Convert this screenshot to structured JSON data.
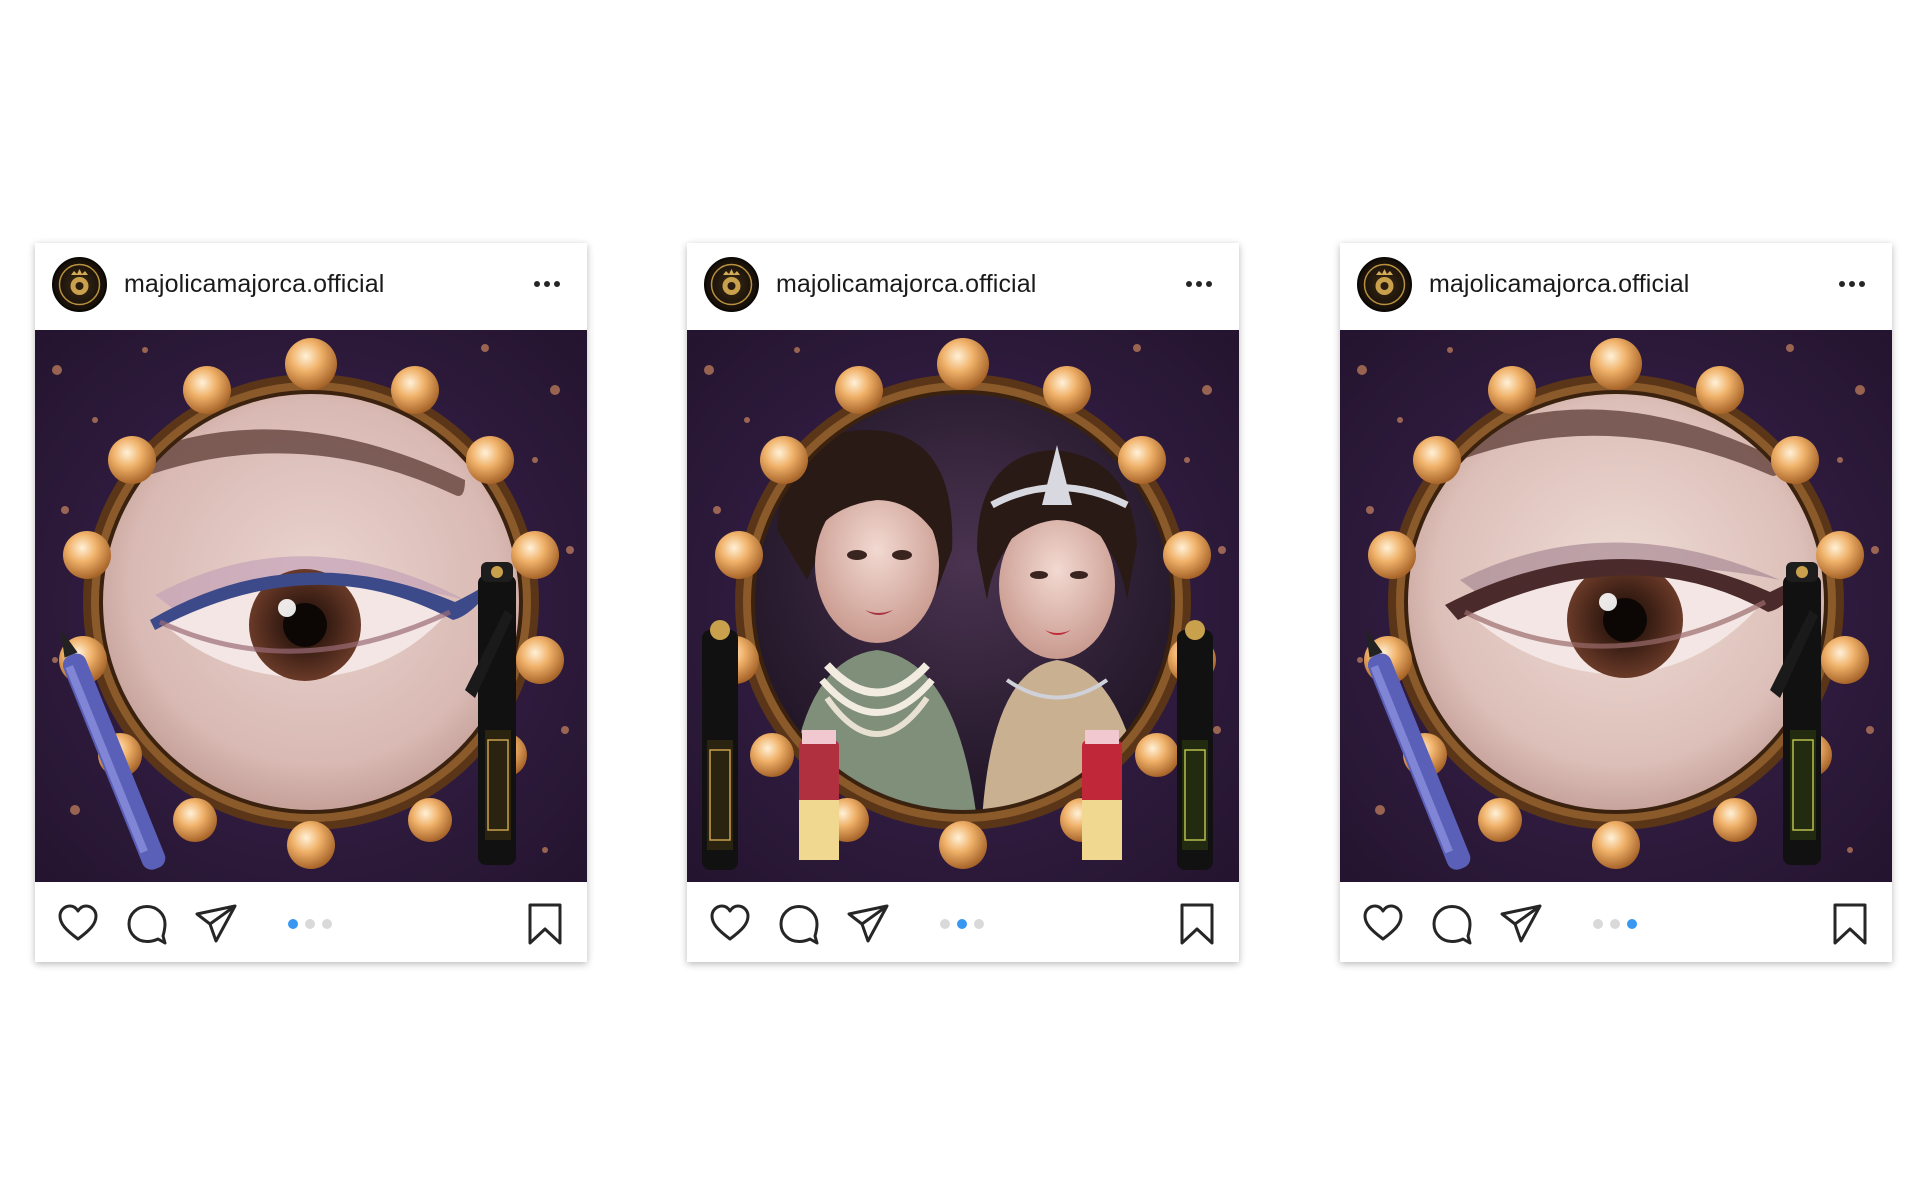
{
  "posts": [
    {
      "username": "majolicamajorca.official",
      "image_subject": "eye-closeup-blue-liner",
      "carousel": {
        "count": 3,
        "active": 1
      }
    },
    {
      "username": "majolicamajorca.official",
      "image_subject": "two-models-1920s-style",
      "carousel": {
        "count": 3,
        "active": 2
      }
    },
    {
      "username": "majolicamajorca.official",
      "image_subject": "eye-closeup-brown-liner",
      "carousel": {
        "count": 3,
        "active": 3
      }
    }
  ],
  "icons": {
    "more": "more-horizontal-icon",
    "like": "heart-icon",
    "comment": "comment-bubble-icon",
    "share": "paper-plane-icon",
    "save": "bookmark-icon"
  },
  "colors": {
    "background_purple": "#2c1a3b",
    "frame_gold": "#8a5a2b",
    "carousel_active": "#3897f0",
    "carousel_inactive": "#d9d9d9"
  }
}
